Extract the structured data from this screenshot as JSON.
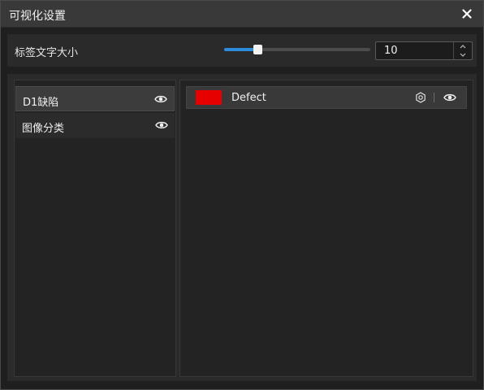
{
  "window": {
    "title": "可视化设置"
  },
  "settings": {
    "label_size_text": "标签文字大小",
    "label_size_value": "10",
    "slider_fraction": 0.22
  },
  "left_list": {
    "items": [
      {
        "label": "D1缺陷",
        "selected": true,
        "icon": "eye-icon"
      },
      {
        "label": "图像分类",
        "selected": false,
        "icon": "eye-icon"
      }
    ]
  },
  "classes": [
    {
      "name": "Defect",
      "color": "#e60000",
      "icons": [
        "gear-icon",
        "eye-icon"
      ]
    }
  ],
  "colors": {
    "accent": "#2f8bdc",
    "background": "#1f1f1f",
    "titlebar": "#393939"
  }
}
